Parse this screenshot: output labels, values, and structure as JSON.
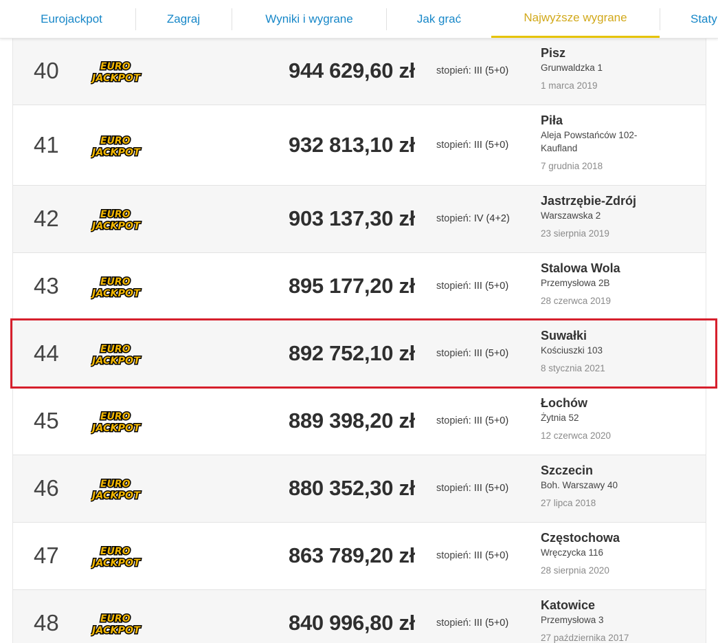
{
  "nav": {
    "tabs": [
      {
        "label": "Eurojackpot"
      },
      {
        "label": "Zagraj"
      },
      {
        "label": "Wyniki i wygrane"
      },
      {
        "label": "Jak grać"
      },
      {
        "label": "Najwyższe wygrane"
      },
      {
        "label": "Staty"
      }
    ],
    "active_tab": "Najwyższe wygrane",
    "colors": {
      "link": "#1787c8",
      "active": "#d2a91b",
      "active_underline": "#e6c300"
    }
  },
  "winnings": {
    "tier_prefix": "stopień:",
    "logo": {
      "line1": "EURO",
      "line2": "JACKPOT",
      "icon": "eurojackpot-logo"
    },
    "highlight_color": "#d61f2c",
    "highlighted_rank": "44",
    "rows": [
      {
        "rank": "40",
        "amount": "944 629,60 zł",
        "tier": "III (5+0)",
        "city": "Pisz",
        "street": "Grunwaldzka 1",
        "date": "1 marca 2019"
      },
      {
        "rank": "41",
        "amount": "932 813,10 zł",
        "tier": "III (5+0)",
        "city": "Piła",
        "street": "Aleja Powstańców 102-Kaufland",
        "date": "7 grudnia 2018"
      },
      {
        "rank": "42",
        "amount": "903 137,30 zł",
        "tier": "IV (4+2)",
        "city": "Jastrzębie-Zdrój",
        "street": "Warszawska 2",
        "date": "23 sierpnia 2019"
      },
      {
        "rank": "43",
        "amount": "895 177,20 zł",
        "tier": "III (5+0)",
        "city": "Stalowa Wola",
        "street": "Przemysłowa 2B",
        "date": "28 czerwca 2019"
      },
      {
        "rank": "44",
        "amount": "892 752,10 zł",
        "tier": "III (5+0)",
        "city": "Suwałki",
        "street": "Kościuszki 103",
        "date": "8 stycznia 2021"
      },
      {
        "rank": "45",
        "amount": "889 398,20 zł",
        "tier": "III (5+0)",
        "city": "Łochów",
        "street": "Żytnia 52",
        "date": "12 czerwca 2020"
      },
      {
        "rank": "46",
        "amount": "880 352,30 zł",
        "tier": "III (5+0)",
        "city": "Szczecin",
        "street": "Boh. Warszawy 40",
        "date": "27 lipca 2018"
      },
      {
        "rank": "47",
        "amount": "863 789,20 zł",
        "tier": "III (5+0)",
        "city": "Częstochowa",
        "street": "Wręczycka 116",
        "date": "28 sierpnia 2020"
      },
      {
        "rank": "48",
        "amount": "840 996,80 zł",
        "tier": "III (5+0)",
        "city": "Katowice",
        "street": "Przemysłowa 3",
        "date": "27 października 2017"
      }
    ]
  }
}
